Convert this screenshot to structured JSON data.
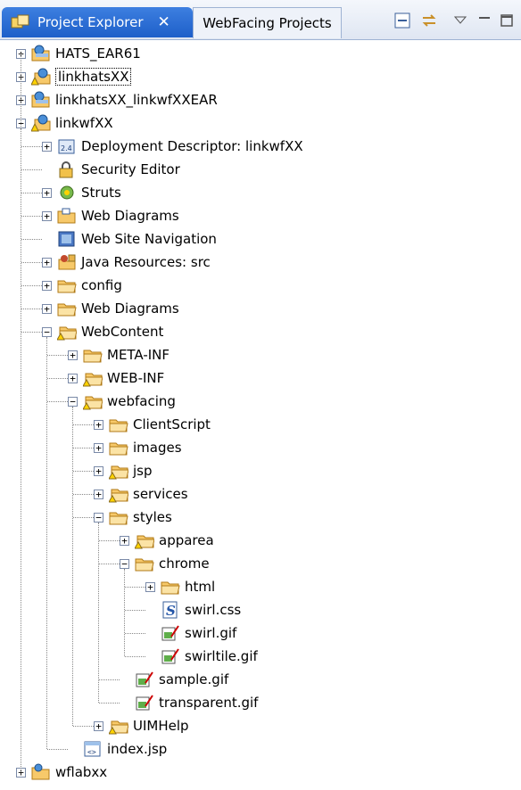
{
  "tabs": {
    "active_label": "Project Explorer",
    "inactive_label": "WebFacing Projects"
  },
  "toolbar": {
    "collapse_icon": "collapse-all-icon",
    "link_icon": "link-with-editor-icon",
    "menu_icon": "view-menu-icon",
    "minimize_icon": "minimize-icon",
    "maximize_icon": "maximize-icon"
  },
  "tree": [
    {
      "label": "HATS_EAR61",
      "depth": 0,
      "toggle": "+",
      "icon": "ear-project"
    },
    {
      "label": "linkhatsXX",
      "depth": 0,
      "toggle": "+",
      "icon": "web-project-warn",
      "selected": true
    },
    {
      "label": "linkhatsXX_linkwfXXEAR",
      "depth": 0,
      "toggle": "+",
      "icon": "ear-project"
    },
    {
      "label": "linkwfXX",
      "depth": 0,
      "toggle": "-",
      "icon": "web-project-warn"
    },
    {
      "label": "Deployment Descriptor: linkwfXX",
      "depth": 1,
      "toggle": "+",
      "icon": "deployment"
    },
    {
      "label": "Security Editor",
      "depth": 1,
      "toggle": "",
      "icon": "security"
    },
    {
      "label": "Struts",
      "depth": 1,
      "toggle": "+",
      "icon": "struts"
    },
    {
      "label": "Web Diagrams",
      "depth": 1,
      "toggle": "+",
      "icon": "webdiagram"
    },
    {
      "label": "Web Site Navigation",
      "depth": 1,
      "toggle": "",
      "icon": "navigation"
    },
    {
      "label": "Java Resources: src",
      "depth": 1,
      "toggle": "+",
      "icon": "java"
    },
    {
      "label": "config",
      "depth": 1,
      "toggle": "+",
      "icon": "folder"
    },
    {
      "label": "Web Diagrams",
      "depth": 1,
      "toggle": "+",
      "icon": "folder"
    },
    {
      "label": "WebContent",
      "depth": 1,
      "toggle": "-",
      "icon": "folder-warn"
    },
    {
      "label": "META-INF",
      "depth": 2,
      "toggle": "+",
      "icon": "folder"
    },
    {
      "label": "WEB-INF",
      "depth": 2,
      "toggle": "+",
      "icon": "folder-warn"
    },
    {
      "label": "webfacing",
      "depth": 2,
      "toggle": "-",
      "icon": "folder-warn"
    },
    {
      "label": "ClientScript",
      "depth": 3,
      "toggle": "+",
      "icon": "folder"
    },
    {
      "label": "images",
      "depth": 3,
      "toggle": "+",
      "icon": "folder"
    },
    {
      "label": "jsp",
      "depth": 3,
      "toggle": "+",
      "icon": "folder-warn"
    },
    {
      "label": "services",
      "depth": 3,
      "toggle": "+",
      "icon": "folder-warn"
    },
    {
      "label": "styles",
      "depth": 3,
      "toggle": "-",
      "icon": "folder"
    },
    {
      "label": "apparea",
      "depth": 4,
      "toggle": "+",
      "icon": "folder-warn"
    },
    {
      "label": "chrome",
      "depth": 4,
      "toggle": "-",
      "icon": "folder"
    },
    {
      "label": "html",
      "depth": 5,
      "toggle": "+",
      "icon": "folder"
    },
    {
      "label": "swirl.css",
      "depth": 5,
      "toggle": "",
      "icon": "css"
    },
    {
      "label": "swirl.gif",
      "depth": 5,
      "toggle": "",
      "icon": "gif"
    },
    {
      "label": "swirltile.gif",
      "depth": 5,
      "toggle": "",
      "icon": "gif"
    },
    {
      "label": "sample.gif",
      "depth": 4,
      "toggle": "",
      "icon": "gif"
    },
    {
      "label": "transparent.gif",
      "depth": 4,
      "toggle": "",
      "icon": "gif"
    },
    {
      "label": "UIMHelp",
      "depth": 3,
      "toggle": "+",
      "icon": "folder-warn"
    },
    {
      "label": "index.jsp",
      "depth": 2,
      "toggle": "",
      "icon": "jsp"
    },
    {
      "label": "wflabxx",
      "depth": 0,
      "toggle": "+",
      "icon": "web-project"
    }
  ]
}
